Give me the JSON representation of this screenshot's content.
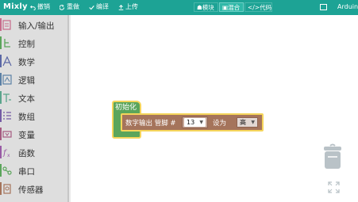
{
  "app": {
    "brand": "Mixly"
  },
  "toolbar": {
    "undo": "撤销",
    "redo": "重做",
    "compile": "编译",
    "upload": "上传"
  },
  "modes": {
    "blocks": "模块",
    "mixed": "混合",
    "code": "</>代码"
  },
  "board": "Arduino",
  "categories": [
    {
      "label": "输入/输出",
      "color": "#c76a8a"
    },
    {
      "label": "控制",
      "color": "#5ba55b"
    },
    {
      "label": "数学",
      "color": "#5b67a5"
    },
    {
      "label": "逻辑",
      "color": "#5b80a5"
    },
    {
      "label": "文本",
      "color": "#5ba58c"
    },
    {
      "label": "数组",
      "color": "#745ba5"
    },
    {
      "label": "变量",
      "color": "#a55b80"
    },
    {
      "label": "函数",
      "color": "#995ba5"
    },
    {
      "label": "串口",
      "color": "#5ba55b"
    },
    {
      "label": "传感器",
      "color": "#a5745b"
    }
  ],
  "blocks": {
    "init_label": "初始化",
    "digital_write_label": "数字输出 管脚 #",
    "pin_value": "13",
    "set_label": "设为",
    "level_value": "高"
  }
}
